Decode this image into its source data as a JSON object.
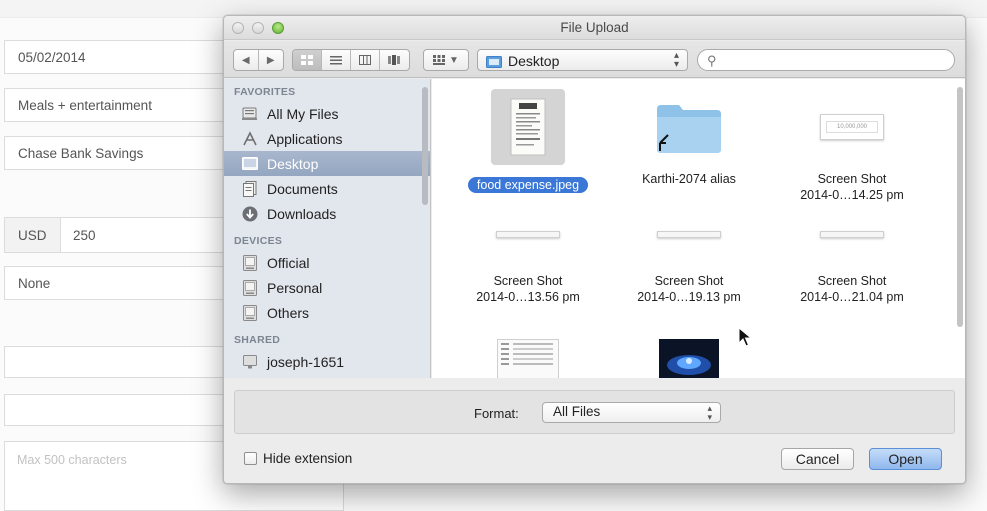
{
  "background_form": {
    "date": "05/02/2014",
    "category": "Meals + entertainment",
    "account": "Chase Bank Savings",
    "currency": "USD",
    "amount": "250",
    "tax": "None",
    "notes_placeholder": "Max 500 characters"
  },
  "dialog": {
    "title": "File Upload",
    "location": "Desktop",
    "search_placeholder": "",
    "sidebar": {
      "favorites_header": "FAVORITES",
      "favorites": [
        {
          "label": "All My Files",
          "icon": "all-files-icon"
        },
        {
          "label": "Applications",
          "icon": "applications-icon"
        },
        {
          "label": "Desktop",
          "icon": "desktop-icon",
          "selected": true
        },
        {
          "label": "Documents",
          "icon": "documents-icon"
        },
        {
          "label": "Downloads",
          "icon": "downloads-icon"
        }
      ],
      "devices_header": "DEVICES",
      "devices": [
        {
          "label": "Official",
          "icon": "disk-icon"
        },
        {
          "label": "Personal",
          "icon": "disk-icon"
        },
        {
          "label": "Others",
          "icon": "disk-icon"
        }
      ],
      "shared_header": "SHARED",
      "shared": [
        {
          "label": "joseph-1651",
          "icon": "network-computer-icon"
        }
      ]
    },
    "files": [
      {
        "name": "food expense.jpeg",
        "selected": true,
        "kind": "receipt-image"
      },
      {
        "name": "Karthi-2074 alias",
        "kind": "folder-alias"
      },
      {
        "name": "Screen Shot",
        "name2": "2014-0…14.25 pm",
        "kind": "screenshot",
        "thumb_text": "10,000,000"
      },
      {
        "name": "Screen Shot",
        "name2": "2014-0…13.56 pm",
        "kind": "screenshot"
      },
      {
        "name": "Screen Shot",
        "name2": "2014-0…19.13 pm",
        "kind": "screenshot"
      },
      {
        "name": "Screen Shot",
        "name2": "2014-0…21.04 pm",
        "kind": "screenshot"
      },
      {
        "name": "",
        "kind": "spreadsheet-image"
      },
      {
        "name": "",
        "kind": "dark-image"
      }
    ],
    "format_label": "Format:",
    "format_value": "All Files",
    "hide_extension_label": "Hide extension",
    "hide_extension_checked": false,
    "cancel_label": "Cancel",
    "open_label": "Open"
  },
  "colors": {
    "selection_blue": "#3a77d6",
    "sidebar_selected": "#a0b1c9",
    "open_button": "#9fc3f1"
  }
}
